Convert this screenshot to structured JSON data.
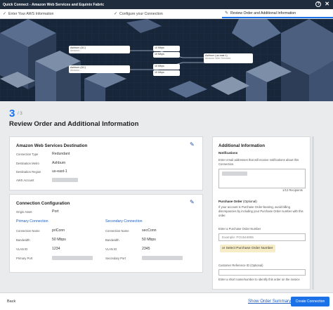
{
  "titlebar": {
    "title": "Quick Connect - Amazon Web Services and Equinix Fabric",
    "help_icon": "question-icon",
    "close_icon": "close-icon"
  },
  "steps": [
    {
      "label": "Enter Your AWS Information",
      "icon": "check-icon"
    },
    {
      "label": "Configure your Connection",
      "icon": "check-icon"
    },
    {
      "label": "Review Order and Additional Information",
      "icon": "pencil-icon"
    }
  ],
  "diagram": {
    "nodes": [
      {
        "title": "Ashburn (DC)",
        "sub": "Amazon..."
      },
      {
        "title": "Ashburn (DC)",
        "sub": "Amazon..."
      },
      {
        "title": "10 Mbps"
      },
      {
        "title": "10 Mbps"
      },
      {
        "title": "10 Mbps"
      },
      {
        "title": "10 Mbps"
      },
      {
        "title": "Ashburn (us-east-1)",
        "sub": "Amazon Web Services"
      }
    ]
  },
  "page": {
    "step_number": "3",
    "step_total": "/ 3",
    "title": "Review Order and Additional Information"
  },
  "aws_destination": {
    "title": "Amazon Web Services Destination",
    "rows": [
      {
        "label": "Connection Type",
        "value": "Redundant"
      },
      {
        "label": "Destination Metro",
        "value": "Ashburn"
      },
      {
        "label": "Destination Region",
        "value": "us-east-1"
      },
      {
        "label": "AWS Account",
        "value": ""
      }
    ]
  },
  "connection_config": {
    "title": "Connection Configuration",
    "origin_label": "Origin Asset",
    "origin_value": "Port",
    "primary": {
      "title": "Primary Connection",
      "rows": [
        {
          "label": "Connection Name",
          "value": "priConn"
        },
        {
          "label": "Bandwidth",
          "value": "50 Mbps"
        },
        {
          "label": "VLAN ID",
          "value": "1234"
        },
        {
          "label": "Primary Port",
          "value": ""
        }
      ]
    },
    "secondary": {
      "title": "Secondary Connection",
      "rows": [
        {
          "label": "Connection Name",
          "value": "secConn"
        },
        {
          "label": "Bandwidth",
          "value": "50 Mbps"
        },
        {
          "label": "VLAN ID",
          "value": "2345"
        },
        {
          "label": "Secondary Port",
          "value": ""
        }
      ]
    }
  },
  "additional": {
    "title": "Additional Information",
    "notifications_label": "Notifications",
    "notifications_help": "Enter email addresses that will receive notifications about this Connection.",
    "recipients_count": "1/12 Recipients",
    "po_label": "Purchase Order",
    "po_optional": "(Optional)",
    "po_help": "If your account is Purchase Order-bearing, avoid billing discrepancies by including your Purchase Order number with this order.",
    "po_input_label": "Enter a Purchase Order Number",
    "po_placeholder": "Example: PO1544855",
    "po_select": "or Select Purchase Order Number",
    "cust_ref_label": "Customer Reference ID (Optional)",
    "cust_ref_help": "Enter a short name/number to identify this order on the invoice"
  },
  "footer": {
    "back": "Back",
    "show_summary": "Show Order Summary",
    "create": "Create Connection"
  },
  "colors": {
    "accent": "#1b72e8",
    "titlebar": "#1f2d3d",
    "select_bg": "#f6ecc5"
  }
}
